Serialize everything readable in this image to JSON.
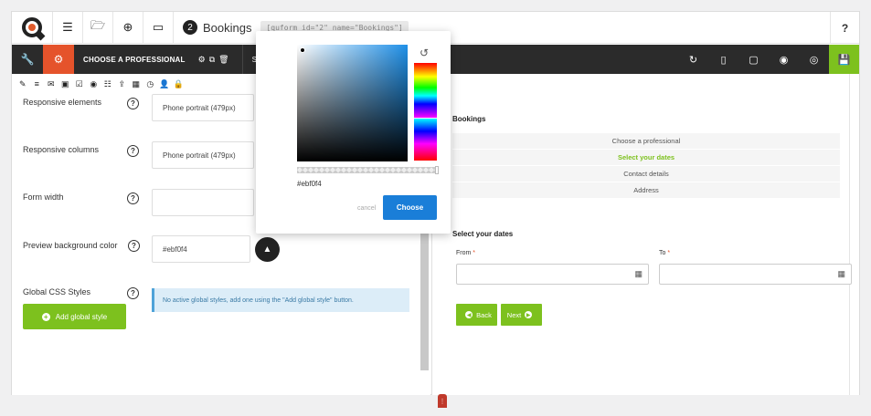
{
  "topbar": {
    "step_number": "2",
    "form_name": "Bookings",
    "shortcode": "[quform id=\"2\" name=\"Bookings\"]",
    "help": "?"
  },
  "darkbar": {
    "step_title": "CHOOSE A PROFESSIONAL",
    "select_label": "SELECT"
  },
  "settings": {
    "responsive_elements": {
      "label": "Responsive elements",
      "value": "Phone portrait (479px)"
    },
    "responsive_columns": {
      "label": "Responsive columns",
      "value": "Phone portrait (479px)"
    },
    "form_width": {
      "label": "Form width",
      "value": ""
    },
    "preview_bg": {
      "label": "Preview background color",
      "value": "#ebf0f4"
    },
    "global_css": {
      "label": "Global CSS Styles",
      "info": "No active global styles, add one using the \"Add global style\" button.",
      "add_button": "Add global style"
    }
  },
  "color_picker": {
    "hex": "#ebf0f4",
    "cancel": "cancel",
    "choose": "Choose"
  },
  "preview": {
    "title": "Bookings",
    "steps": [
      {
        "label": "Choose a professional",
        "active": false
      },
      {
        "label": "Select your dates",
        "active": true
      },
      {
        "label": "Contact details",
        "active": false
      },
      {
        "label": "Address",
        "active": false
      }
    ],
    "section_title": "Select your dates",
    "from_label": "From",
    "to_label": "To",
    "required_mark": "*",
    "back_button": "Back",
    "next_button": "Next"
  },
  "colors": {
    "accent_orange": "#e5532b",
    "accent_green": "#7dc11e",
    "primary_blue": "#1a7ed8",
    "dark_toolbar": "#2b2b2b"
  }
}
